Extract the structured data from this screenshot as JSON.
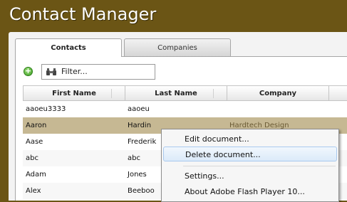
{
  "app": {
    "title": "Contact Manager"
  },
  "tabs": [
    {
      "label": "Contacts",
      "active": true
    },
    {
      "label": "Companies",
      "active": false
    }
  ],
  "toolbar": {
    "add_icon": "add-icon",
    "filter_placeholder": "Filter..."
  },
  "table": {
    "columns": [
      "First Name",
      "Last Name",
      "Company"
    ],
    "rows": [
      [
        "aaoeu3333",
        "aaoeu",
        ""
      ],
      [
        "Aaron",
        "Hardin",
        "Hardtech Design"
      ],
      [
        "Aase",
        "Frederik",
        ""
      ],
      [
        "abc",
        "abc",
        ""
      ],
      [
        "Adam",
        "Jones",
        ""
      ],
      [
        "Alex",
        "Beeboo",
        ""
      ]
    ],
    "selected_row": 1
  },
  "context_menu": {
    "items": [
      "Edit document...",
      "Delete document...",
      "Settings...",
      "About Adobe Flash Player 10..."
    ],
    "hovered": 1
  },
  "colors": {
    "header_bg": "#6b5515",
    "selected_row": "#c6b893",
    "menu_hover": "#dbeaf9"
  }
}
